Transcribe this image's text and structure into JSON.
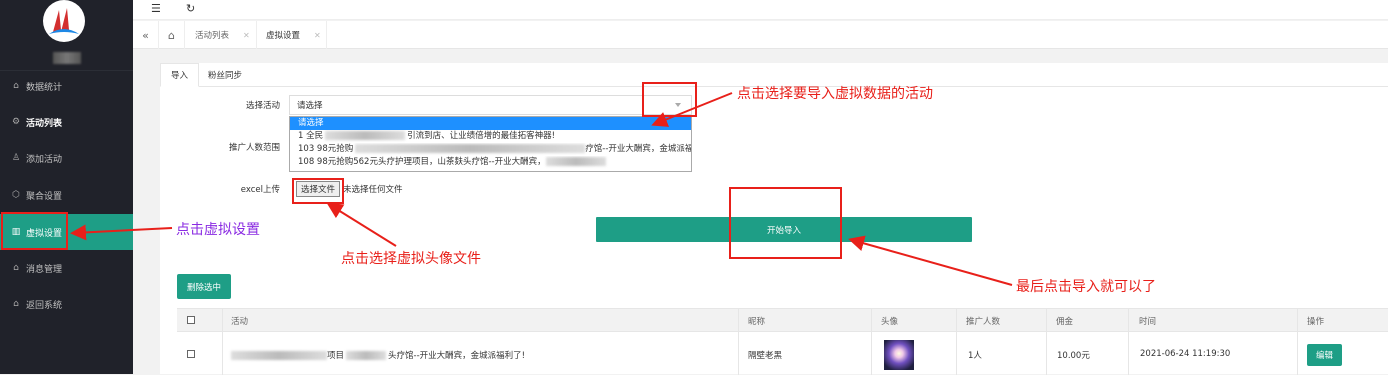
{
  "sidebar": {
    "items": [
      {
        "label": "数据统计",
        "icon": "home-icon"
      },
      {
        "label": "活动列表",
        "icon": "gear-icon"
      },
      {
        "label": "添加活动",
        "icon": "user-icon"
      },
      {
        "label": "聚合设置",
        "icon": "cube-icon"
      },
      {
        "label": "虚拟设置",
        "icon": "bars-icon"
      },
      {
        "label": "消息管理",
        "icon": "home-icon"
      },
      {
        "label": "返回系统",
        "icon": "home-icon"
      }
    ]
  },
  "tabs": [
    {
      "label": "活动列表"
    },
    {
      "label": "虚拟设置"
    }
  ],
  "subtabs": [
    "导入",
    "粉丝同步"
  ],
  "form": {
    "activity_label": "选择活动",
    "select_value": "请选择",
    "options": [
      "请选择",
      "1 全民",
      "103 98元抢购",
      "108 98元抢购562元头疗护理项目，山茶麸头疗馆--开业大酬宾，"
    ],
    "option1_tail": "引流到店、让业绩倍增的最佳拓客神器!",
    "option2_tail": "疗馆--开业大酬宾，金城派福利了!",
    "range_label": "推广人数范围",
    "excel_label": "excel上传",
    "file_button": "选择文件",
    "file_status": "未选择任何文件",
    "import_button": "开始导入"
  },
  "delete_button": "删除选中",
  "table": {
    "columns": [
      "活动",
      "昵称",
      "头像",
      "推广人数",
      "佣金",
      "时间",
      "操作"
    ],
    "rows": [
      {
        "activity_a": "项目",
        "activity_b": "头疗馆--开业大酬宾，金城派福利了!",
        "nickname": "隔壁老黑",
        "promoters": "1人",
        "commission": "10.00元",
        "time": "2021-06-24 11:19:30",
        "action": "编辑"
      }
    ]
  },
  "annotations": {
    "select_activity": "点击选择要导入虚拟数据的活动",
    "click_virtual": "点击虚拟设置",
    "select_file": "点击选择虚拟头像文件",
    "final_import": "最后点击导入就可以了"
  },
  "colors": {
    "accent": "#1e9e86",
    "annotation": "#e8201a",
    "annotation_purple": "#8a2be2",
    "sidebar_bg": "#20222a"
  }
}
